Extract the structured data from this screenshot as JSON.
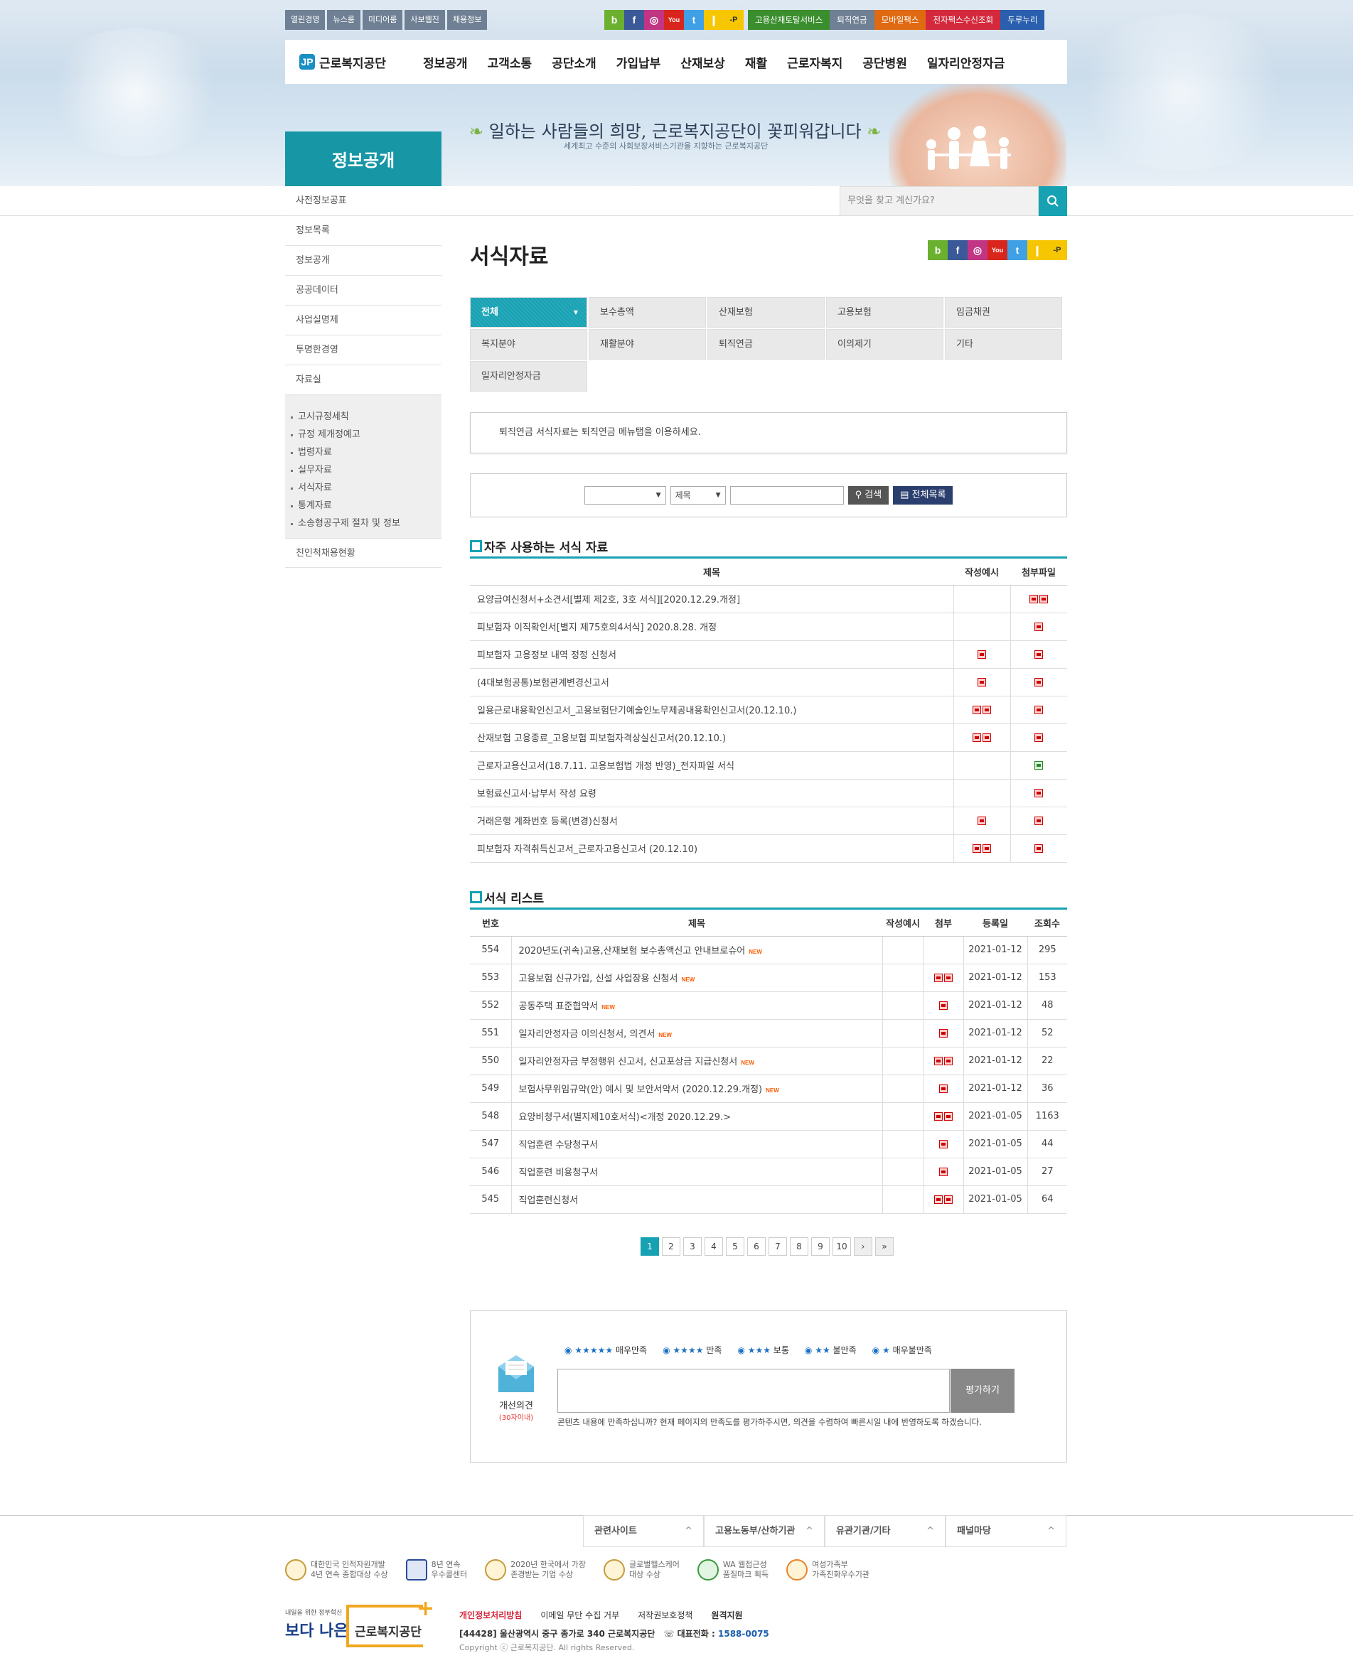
{
  "util_links": [
    "열린경영",
    "뉴스룸",
    "미디어룸",
    "사보웹진",
    "채용정보"
  ],
  "sns": [
    "b",
    "f",
    "◎",
    "You",
    "t",
    "❙",
    "-P"
  ],
  "service_links": [
    {
      "label": "고용산재토탈서비스",
      "color": "#3a8e2e"
    },
    {
      "label": "퇴직연금",
      "color": "#6f8094"
    },
    {
      "label": "모바일팩스",
      "color": "#e06a12"
    },
    {
      "label": "전자팩스수신조회",
      "color": "#d4293c"
    },
    {
      "label": "두루누리",
      "color": "#2a5fae"
    }
  ],
  "logo": {
    "mark": "JP",
    "text": "근로복지공단"
  },
  "gnb": [
    "정보공개",
    "고객소통",
    "공단소개",
    "가입납부",
    "산재보상",
    "재활",
    "근로자복지",
    "공단병원",
    "일자리안정자금"
  ],
  "banner": {
    "title": "정보공개",
    "slogan": "일하는 사람들의 희망, 근로복지공단이 꽃피워갑니다",
    "slogan_sub": "세계최고 수준의 사회보장서비스기관을 지향하는 근로복지공단"
  },
  "search": {
    "placeholder": "무엇을 찾고 계신가요?"
  },
  "lnb": {
    "items_top": [
      "사전정보공표",
      "정보목록",
      "정보공개",
      "공공데이터",
      "사업실명제",
      "투명한경영",
      "자료실"
    ],
    "sub": [
      "고시규정세칙",
      "규정 제개정예고",
      "법령자료",
      "실무자료",
      "서식자료",
      "통계자료",
      "소송형공구제 절차 및 정보"
    ],
    "items_bottom": [
      "친인척채용현황"
    ]
  },
  "page": {
    "title": "서식자료"
  },
  "categories": [
    "전체",
    "보수총액",
    "산재보험",
    "고용보험",
    "임금채권",
    "복지분야",
    "재활분야",
    "퇴직연금",
    "이의제기",
    "기타",
    "일자리안정자금"
  ],
  "notice": "퇴직연금 서식자료는 퇴직연금 메뉴탭을 이용하세요.",
  "search_form": {
    "sel1": "",
    "sel2": "제목",
    "search_btn": "검색",
    "list_btn": "전체목록"
  },
  "frequent": {
    "title": "자주 사용하는 서식 자료",
    "headers": [
      "제목",
      "작성예시",
      "첨부파일"
    ],
    "rows": [
      {
        "title": "요양급여신청서+소견서[별제 제2호, 3호 서식][2020.12.29.개정]",
        "ex": 0,
        "att": 2
      },
      {
        "title": "피보험자 이직확인서[별지 제75호의4서식] 2020.8.28. 개정",
        "ex": 0,
        "att": 1
      },
      {
        "title": "피보험자 고용정보 내역 정정 신청서",
        "ex": 1,
        "att": 1
      },
      {
        "title": "(4대보험공통)보험관계변경신고서",
        "ex": 1,
        "att": 1
      },
      {
        "title": "일용근로내용확인신고서_고용보험단기예술인노무제공내용확인신고서(20.12.10.)",
        "ex": 2,
        "att": 1
      },
      {
        "title": "산재보험 고용종료_고용보험 피보험자격상실신고서(20.12.10.)",
        "ex": 2,
        "att": 1
      },
      {
        "title": "근로자고용신고서(18.7.11. 고용보험법 개정 반영)_전자파일 서식",
        "ex": 0,
        "att": -1
      },
      {
        "title": "보험료신고서·납부서 작성 요령",
        "ex": 0,
        "att": 1
      },
      {
        "title": "거래은행 계좌번호 등록(변경)신청서",
        "ex": 1,
        "att": 1
      },
      {
        "title": "피보험자 자격취득신고서_근로자고용신고서 (20.12.10)",
        "ex": 2,
        "att": 1
      }
    ]
  },
  "list": {
    "title": "서식 리스트",
    "headers": [
      "번호",
      "제목",
      "작성예시",
      "첨부",
      "등록일",
      "조회수"
    ],
    "new_label": "NEW",
    "rows": [
      {
        "no": "554",
        "title": "2020년도(귀속)고용,산재보험 보수총액신고 안내브로슈어",
        "new": true,
        "att": 0,
        "date": "2021-01-12",
        "views": "295"
      },
      {
        "no": "553",
        "title": "고용보험 신규가입, 신설 사업장용 신청서",
        "new": true,
        "att": 2,
        "date": "2021-01-12",
        "views": "153"
      },
      {
        "no": "552",
        "title": "공동주택 표준협약서",
        "new": true,
        "att": 1,
        "date": "2021-01-12",
        "views": "48"
      },
      {
        "no": "551",
        "title": "일자리안정자금 이의신청서, 의견서",
        "new": true,
        "att": 1,
        "date": "2021-01-12",
        "views": "52"
      },
      {
        "no": "550",
        "title": "일자리안정자금 부정행위 신고서, 신고포상금 지급신청서",
        "new": true,
        "att": 2,
        "date": "2021-01-12",
        "views": "22"
      },
      {
        "no": "549",
        "title": "보험사무위임규약(안) 예시 및 보안서약서 (2020.12.29.개정)",
        "new": true,
        "att": 1,
        "date": "2021-01-12",
        "views": "36"
      },
      {
        "no": "548",
        "title": "요양비청구서(별지제10호서식)<개정 2020.12.29.>",
        "new": false,
        "att": 2,
        "date": "2021-01-05",
        "views": "1163"
      },
      {
        "no": "547",
        "title": "직업훈련 수당청구서",
        "new": false,
        "att": 1,
        "date": "2021-01-05",
        "views": "44"
      },
      {
        "no": "546",
        "title": "직업훈련 비용청구서",
        "new": false,
        "att": 1,
        "date": "2021-01-05",
        "views": "27"
      },
      {
        "no": "545",
        "title": "직업훈련신청서",
        "new": false,
        "att": 2,
        "date": "2021-01-05",
        "views": "64"
      }
    ]
  },
  "pager": {
    "pages": [
      "1",
      "2",
      "3",
      "4",
      "5",
      "6",
      "7",
      "8",
      "9",
      "10"
    ],
    "current": "1",
    "next": "›",
    "last": "»"
  },
  "survey": {
    "icon_label": "개선의견",
    "icon_sub": "(30자이내)",
    "options": [
      {
        "stars": "★★★★★",
        "label": "매우만족"
      },
      {
        "stars": "★★★★",
        "label": "만족"
      },
      {
        "stars": "★★★",
        "label": "보통"
      },
      {
        "stars": "★★",
        "label": "불만족"
      },
      {
        "stars": "★",
        "label": "매우불만족"
      }
    ],
    "submit": "평가하기",
    "desc": "콘텐츠 내용에 만족하십니까? 현재 페이지의 만족도를 평가하주시면, 의견을 수렴하여 빠른시일 내에 반영하도록 하겠습니다."
  },
  "footer_sites": [
    "관련사이트",
    "고용노동부/산하기관",
    "유관기관/기타",
    "패널마당"
  ],
  "awards": [
    {
      "l1": "대한민국 인적자원개발",
      "l2": "4년 연속 종합대상 수상"
    },
    {
      "l1": "8년 연속",
      "l2": "우수콜센터"
    },
    {
      "l1": "2020년 한국에서 가장",
      "l2": "존경받는 기업 수상"
    },
    {
      "l1": "글로벌헬스케어",
      "l2": "대상 수상"
    },
    {
      "l1": "WA 웹접근성",
      "l2": "품질마크 획득"
    },
    {
      "l1": "여성가족부",
      "l2": "가족친화우수기관"
    }
  ],
  "footer": {
    "brand_small": "내일을 위한 정부혁신",
    "brand_big": "보다 나은",
    "brand_name": "근로복지공단",
    "links": [
      "개인정보처리방침",
      "이메일 무단 수집 거부",
      "저작권보호정책",
      "원격지원"
    ],
    "address": "[44428] 울산광역시 중구 종가로 340 근로복지공단",
    "tel_label": "대표전화 :",
    "tel": "1588-0075",
    "copyright": "Copyright ⓒ 근로복지공단. All rights Reserved."
  }
}
